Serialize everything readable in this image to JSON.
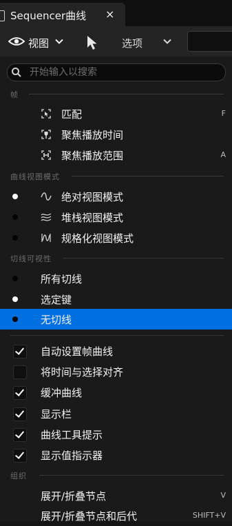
{
  "tab": {
    "title": "Sequencer曲线",
    "close": "×"
  },
  "toolbar": {
    "view_label": "视图",
    "options_label": "选项"
  },
  "search": {
    "placeholder": "开始输入以搜索",
    "value": ""
  },
  "sections": {
    "frame": "帧",
    "curve_view_mode": "曲线视图模式",
    "tangent_visibility": "切线可视性",
    "organize": "组织"
  },
  "frame_items": [
    {
      "label": "匹配",
      "shortcut": "F"
    },
    {
      "label": "聚焦播放时间",
      "shortcut": ""
    },
    {
      "label": "聚焦播放范围",
      "shortcut": "A"
    }
  ],
  "view_mode_items": [
    {
      "label": "绝对视图模式",
      "selected": true
    },
    {
      "label": "堆栈视图模式",
      "selected": false
    },
    {
      "label": "规格化视图模式",
      "selected": false
    }
  ],
  "tangent_items": [
    {
      "label": "所有切线",
      "selected": false
    },
    {
      "label": "选定键",
      "selected": true
    },
    {
      "label": "无切线",
      "selected": false,
      "highlighted": true
    }
  ],
  "toggle_items": [
    {
      "label": "自动设置帧曲线",
      "checked": true
    },
    {
      "label": "将时间与选择对齐",
      "checked": false
    },
    {
      "label": "缓冲曲线",
      "checked": true
    },
    {
      "label": "显示栏",
      "checked": true
    },
    {
      "label": "曲线工具提示",
      "checked": true
    },
    {
      "label": "显示值指示器",
      "checked": true
    }
  ],
  "organize_items": [
    {
      "label": "展开/折叠节点",
      "shortcut": "V"
    },
    {
      "label": "展开/折叠节点和后代",
      "shortcut": "SHIFT+V"
    }
  ]
}
